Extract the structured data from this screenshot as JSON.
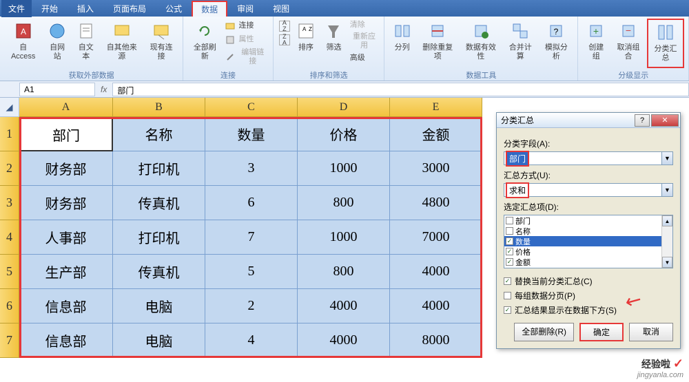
{
  "menu": {
    "file": "文件",
    "home": "开始",
    "insert": "插入",
    "layout": "页面布局",
    "formula": "公式",
    "data": "数据",
    "review": "审阅",
    "view": "视图"
  },
  "ribbon": {
    "ext": {
      "access": "自 Access",
      "web": "自网站",
      "text": "自文本",
      "other": "自其他来源",
      "conn": "现有连接",
      "label": "获取外部数据"
    },
    "conn": {
      "refresh": "全部刷新",
      "connections": "连接",
      "props": "属性",
      "edit": "编辑链接",
      "label": "连接"
    },
    "sort": {
      "az": "A↓Z",
      "za": "Z↓A",
      "sort": "排序",
      "filter": "筛选",
      "clear": "清除",
      "reapply": "重新应用",
      "adv": "高级",
      "label": "排序和筛选"
    },
    "tools": {
      "split": "分列",
      "dup": "删除重复项",
      "valid": "数据有效性",
      "consol": "合并计算",
      "whatif": "模拟分析",
      "label": "数据工具"
    },
    "outline": {
      "group": "创建组",
      "ungroup": "取消组合",
      "subtotal": "分类汇总",
      "label": "分级显示"
    }
  },
  "namebox": "A1",
  "formula": "部门",
  "cols": [
    "A",
    "B",
    "C",
    "D",
    "E"
  ],
  "rows": [
    "1",
    "2",
    "3",
    "4",
    "5",
    "6",
    "7"
  ],
  "chart_data": {
    "type": "table",
    "headers": [
      "部门",
      "名称",
      "数量",
      "价格",
      "金额"
    ],
    "rows": [
      [
        "财务部",
        "打印机",
        "3",
        "1000",
        "3000"
      ],
      [
        "财务部",
        "传真机",
        "6",
        "800",
        "4800"
      ],
      [
        "人事部",
        "打印机",
        "7",
        "1000",
        "7000"
      ],
      [
        "生产部",
        "传真机",
        "5",
        "800",
        "4000"
      ],
      [
        "信息部",
        "电脑",
        "2",
        "4000",
        "4000"
      ],
      [
        "信息部",
        "电脑",
        "4",
        "4000",
        "8000"
      ]
    ]
  },
  "dialog": {
    "title": "分类汇总",
    "field_label": "分类字段(A):",
    "field_value": "部门",
    "method_label": "汇总方式(U):",
    "method_value": "求和",
    "items_label": "选定汇总项(D):",
    "items": [
      {
        "label": "部门",
        "checked": false
      },
      {
        "label": "名称",
        "checked": false
      },
      {
        "label": "数量",
        "checked": true,
        "sel": true
      },
      {
        "label": "价格",
        "checked": true
      },
      {
        "label": "金额",
        "checked": true
      }
    ],
    "opt1": "替换当前分类汇总(C)",
    "opt2": "每组数据分页(P)",
    "opt3": "汇总结果显示在数据下方(S)",
    "btn_removeall": "全部删除(R)",
    "btn_ok": "确定",
    "btn_cancel": "取消"
  },
  "watermark": {
    "line1": "经验啦",
    "line2": "jingyanla.com"
  }
}
